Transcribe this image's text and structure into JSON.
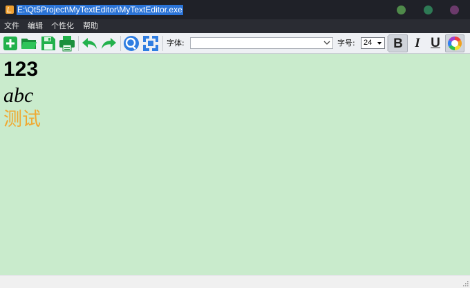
{
  "window": {
    "title": "E:\\Qt5Project\\MyTextEditor\\MyTextEditor.exe",
    "controls": [
      "minimize-dot",
      "maximize-dot",
      "close-dot"
    ]
  },
  "menu": {
    "items": [
      {
        "label": "文件"
      },
      {
        "label": "编辑"
      },
      {
        "label": "个性化"
      },
      {
        "label": "帮助"
      }
    ]
  },
  "toolbar": {
    "icons": [
      "new-file-icon",
      "open-folder-icon",
      "save-icon",
      "print-icon",
      "undo-icon",
      "redo-icon",
      "zoom-icon",
      "fit-icon"
    ],
    "font_label": "字体:",
    "font_value": "",
    "size_label": "字号:",
    "size_value": "24",
    "bold_label": "B",
    "italic_label": "I",
    "underline_label": "U",
    "bold_active": true,
    "color_active": true
  },
  "editor": {
    "background": "#c9ebcc",
    "lines": [
      {
        "text": "123",
        "style": "bold",
        "color": "#000000"
      },
      {
        "text": "abc",
        "style": "italic",
        "color": "#000000"
      },
      {
        "text": "测试",
        "style": "normal",
        "color": "#f0a830"
      }
    ]
  },
  "colors": {
    "titlebar": "#1f2128",
    "menubar": "#2a2c33",
    "title_highlight": "#2a73d6",
    "icon_green": "#22b14c",
    "icon_blue": "#2f7de1"
  }
}
